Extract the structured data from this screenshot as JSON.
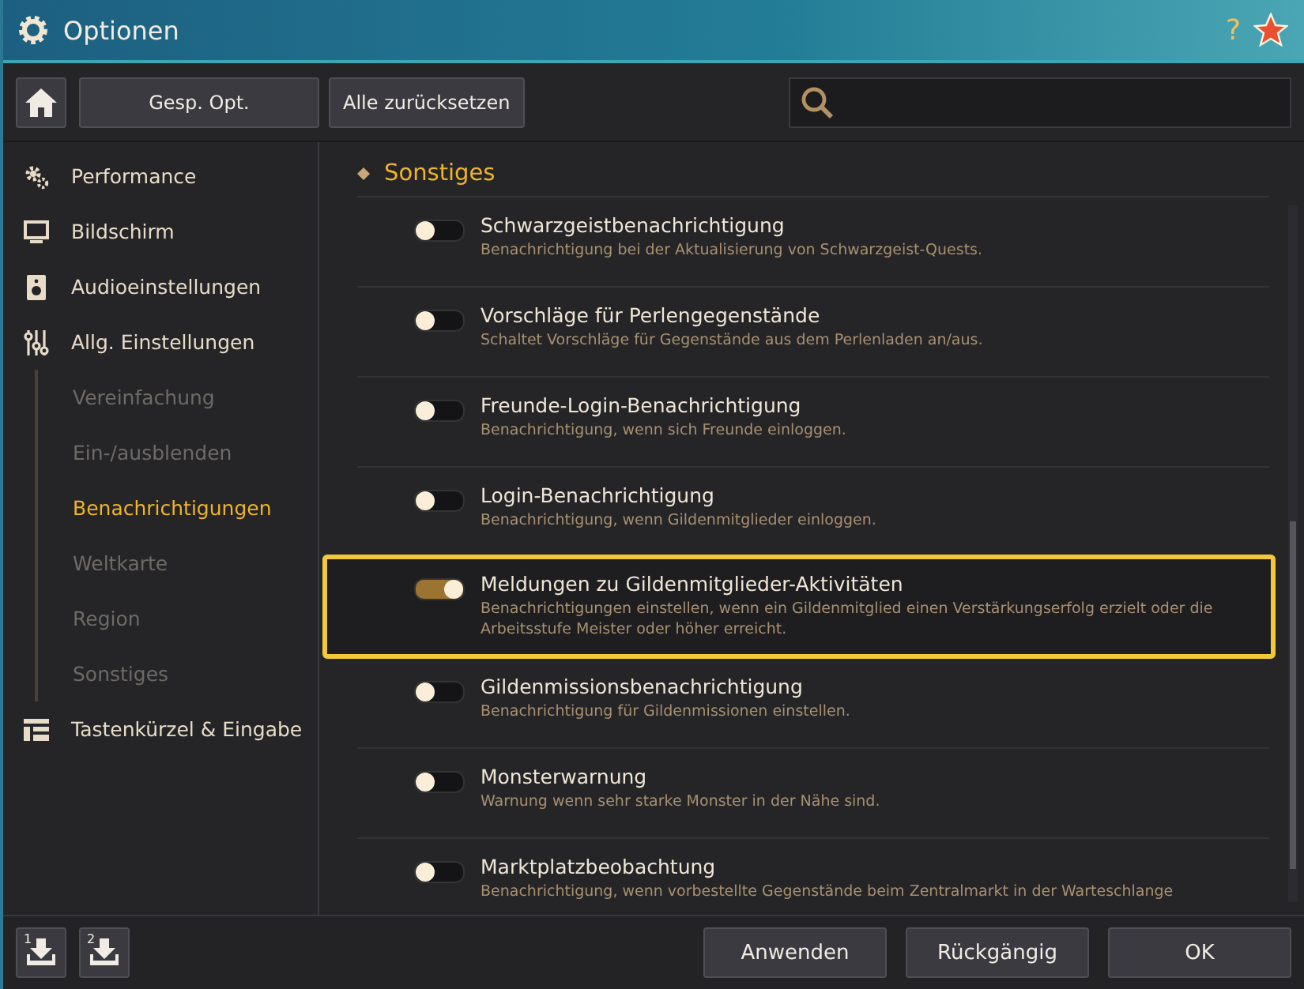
{
  "window": {
    "title": "Optionen",
    "help": "?"
  },
  "toolbar": {
    "saved_options": "Gesp. Opt.",
    "reset_all": "Alle zurücksetzen"
  },
  "sidebar": {
    "items": [
      {
        "label": "Performance",
        "selected": false
      },
      {
        "label": "Bildschirm",
        "selected": false
      },
      {
        "label": "Audioeinstellungen",
        "selected": false
      },
      {
        "label": "Allg. Einstellungen",
        "selected": false,
        "children": [
          {
            "label": "Vereinfachung",
            "selected": false
          },
          {
            "label": "Ein-/ausblenden",
            "selected": false
          },
          {
            "label": "Benachrichtigungen",
            "selected": true
          },
          {
            "label": "Weltkarte",
            "selected": false
          },
          {
            "label": "Region",
            "selected": false
          },
          {
            "label": "Sonstiges",
            "selected": false
          }
        ]
      },
      {
        "label": "Tastenkürzel & Eingabe",
        "selected": false
      }
    ]
  },
  "section": {
    "title": "Sonstiges",
    "items": [
      {
        "title": "Schwarzgeistbenachrichtigung",
        "description": "Benachrichtigung bei der Aktualisierung von Schwarzgeist-Quests.",
        "on": false,
        "highlighted": false
      },
      {
        "title": "Vorschläge für Perlengegenstände",
        "description": "Schaltet Vorschläge für Gegenstände aus dem Perlenladen an/aus.",
        "on": false,
        "highlighted": false
      },
      {
        "title": "Freunde-Login-Benachrichtigung",
        "description": "Benachrichtigung, wenn sich Freunde einloggen.",
        "on": false,
        "highlighted": false
      },
      {
        "title": "Login-Benachrichtigung",
        "description": "Benachrichtigung, wenn Gildenmitglieder einloggen.",
        "on": false,
        "highlighted": false
      },
      {
        "title": "Meldungen zu Gildenmitglieder-Aktivitäten",
        "description": "Benachrichtigungen einstellen, wenn ein Gildenmitglied einen Verstärkungserfolg erzielt oder die Arbeitsstufe Meister oder höher erreicht.",
        "on": true,
        "highlighted": true
      },
      {
        "title": "Gildenmissionsbenachrichtigung",
        "description": "Benachrichtigung für Gildenmissionen einstellen.",
        "on": false,
        "highlighted": false
      },
      {
        "title": "Monsterwarnung",
        "description": "Warnung wenn sehr starke Monster in der Nähe sind.",
        "on": false,
        "highlighted": false
      },
      {
        "title": "Marktplatzbeobachtung",
        "description": "Benachrichtigung, wenn vorbestellte Gegenstände beim Zentralmarkt in der Warteschlange",
        "on": false,
        "highlighted": false
      }
    ]
  },
  "footer": {
    "slots": [
      "1",
      "2"
    ],
    "buttons": [
      "Anwenden",
      "Rückgängig",
      "OK"
    ]
  }
}
